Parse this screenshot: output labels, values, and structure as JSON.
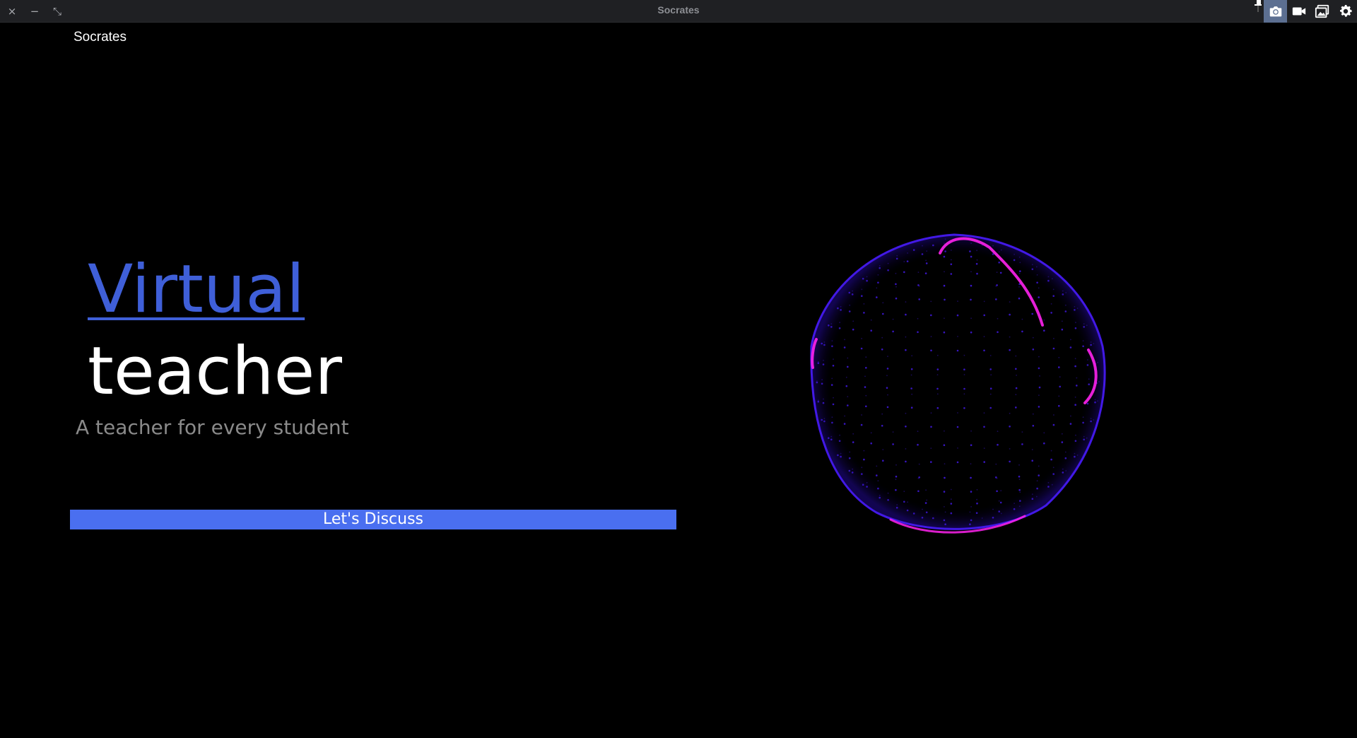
{
  "window": {
    "title": "Socrates",
    "controls": {
      "close": "×",
      "minimize": "−",
      "restore": "⤡"
    },
    "tray_icons": [
      "pin-icon",
      "camera-icon",
      "video-camera-icon",
      "gallery-icon",
      "gear-icon"
    ]
  },
  "app": {
    "name": "Socrates"
  },
  "hero": {
    "word_1": "Virtual",
    "word_2": "teacher",
    "tagline": "A teacher for every student"
  },
  "cta": {
    "label": "Let's Discuss"
  },
  "colors": {
    "accent": "#3f5fd8",
    "button": "#4a6ff0",
    "orb_primary": "#4a1cff",
    "orb_highlight": "#ff22ee",
    "background": "#000000"
  }
}
